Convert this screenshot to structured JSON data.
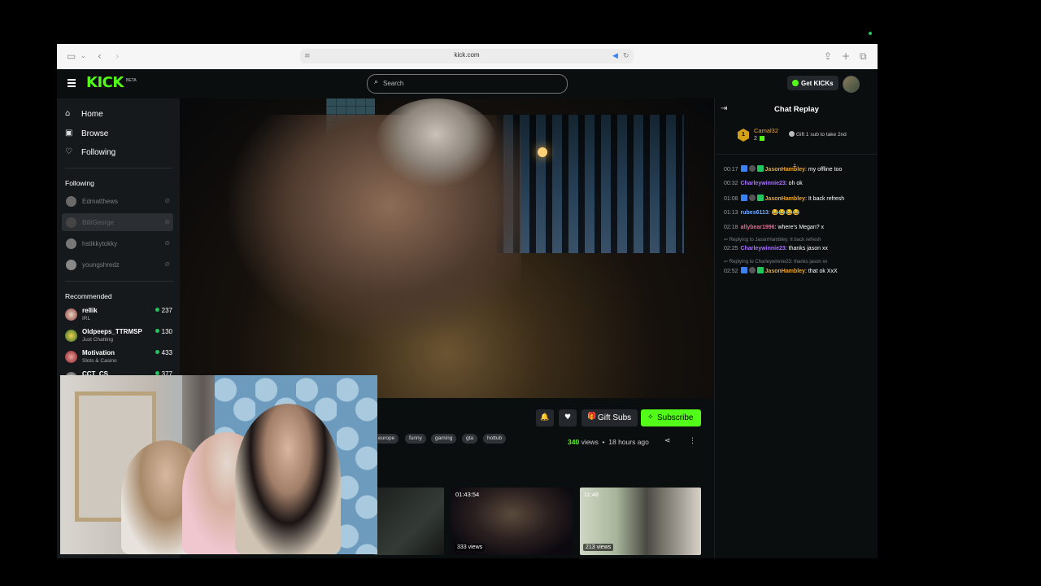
{
  "browser": {
    "url": "kick.com"
  },
  "header": {
    "logo": "KICK",
    "beta": "BETA",
    "search_placeholder": "Search",
    "get_kicks": "Get KICKs"
  },
  "sidebar": {
    "nav": [
      {
        "label": "Home",
        "icon": "home-icon"
      },
      {
        "label": "Browse",
        "icon": "browse-icon"
      },
      {
        "label": "Following",
        "icon": "heart-icon"
      }
    ],
    "following_title": "Following",
    "following": [
      {
        "name": "Edmatthews"
      },
      {
        "name": "BilliGeorge"
      },
      {
        "name": "hstikkytokky"
      },
      {
        "name": "youngshredz"
      }
    ],
    "recommended_title": "Recommended",
    "recommended": [
      {
        "name": "rellik",
        "category": "IRL",
        "viewers": "237"
      },
      {
        "name": "Oldpeeps_TTRMSP",
        "category": "Just Chatting",
        "viewers": "130"
      },
      {
        "name": "Motivation",
        "category": "Slots & Casino",
        "viewers": "433"
      },
      {
        "name": "CCT_CS",
        "category": "",
        "viewers": "377"
      }
    ]
  },
  "stream": {
    "gift_subs": "Gift Subs",
    "subscribe": "Subscribe",
    "tags": [
      "europe",
      "funny",
      "gaming",
      "gta",
      "hottub"
    ],
    "views_count": "340",
    "views_label": "views",
    "age": "18 hours ago"
  },
  "clips": [
    {
      "duration": "",
      "views": ""
    },
    {
      "duration": "01:43:54",
      "views": "333 views"
    },
    {
      "duration": "11:48",
      "views": "213 views"
    }
  ],
  "chat": {
    "title": "Chat Replay",
    "pinned": {
      "rank": "1",
      "user": "Camal32",
      "count": "2",
      "gift_text": "Gift 1 sub to take 2nd"
    },
    "messages": [
      {
        "time": "00:17",
        "user": "JasonHambley",
        "text": ": my offline too"
      },
      {
        "time": "00:32",
        "user": "Charleywinnie23",
        "text": ": oh ok"
      },
      {
        "time": "01:08",
        "user": "JasonHambley",
        "text": ": It back refresh"
      },
      {
        "time": "01:13",
        "user": "rubes6113",
        "text": ": 😂😂😂😂"
      },
      {
        "time": "02:18",
        "user": "allybear1996",
        "text": ": where's Megan? x"
      },
      {
        "time": "02:25",
        "user": "Charleywinnie23",
        "text": ": thanks jason xx",
        "reply": "Replying to JasonHambley: It back refresh"
      },
      {
        "time": "02:52",
        "user": "JasonHambley",
        "text": ": that ok XxX",
        "reply": "Replying to Charleywinnie23: thanks jason xx"
      }
    ]
  },
  "colors": {
    "brand": "#53fc18",
    "user_orange": "#f5a623",
    "user_purple": "#a970ff",
    "user_blue": "#6fa8ff",
    "user_pink": "#ff5c8a"
  }
}
